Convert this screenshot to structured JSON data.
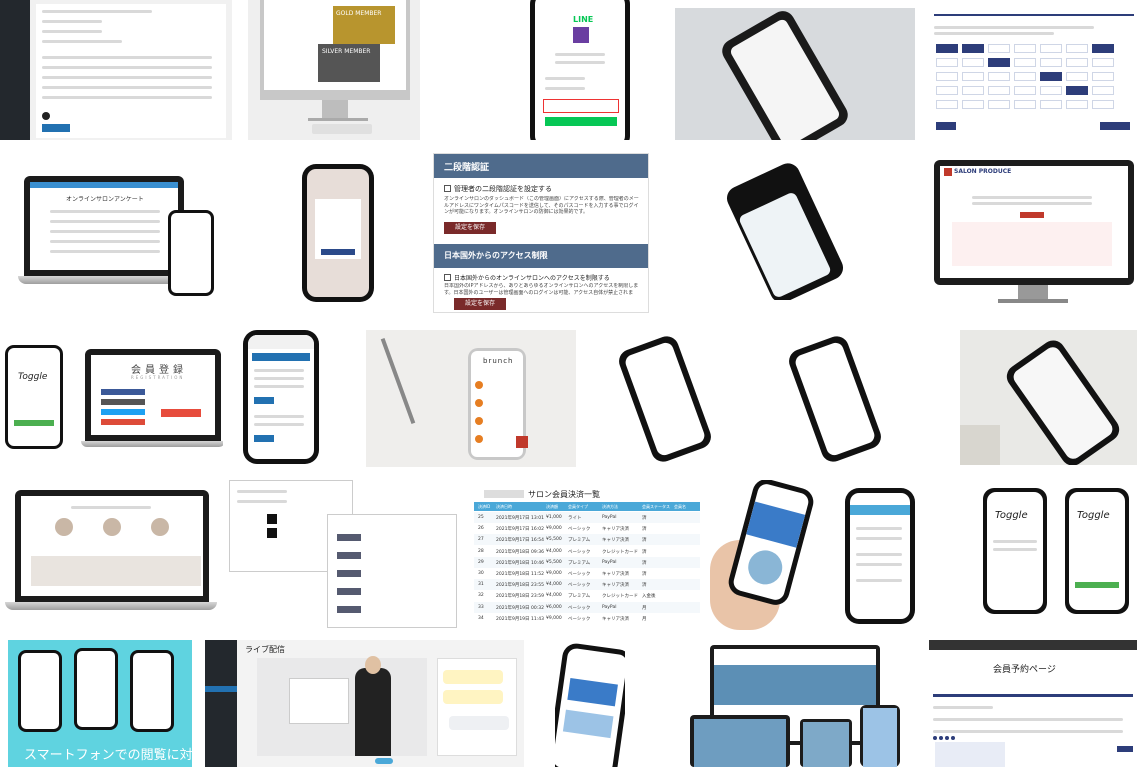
{
  "tiles": {
    "silver": {
      "gold_label": "GOLD MEMBER",
      "silver_label": "SILVER MEMBER"
    },
    "line_phone": {
      "brand": "LINE"
    },
    "online_salon": {
      "title": "オンラインサロンアンケート"
    },
    "security": {
      "two_factor_heading": "二段階認証",
      "two_factor_checkbox": "管理者の二段階認証を設定する",
      "two_factor_desc": "オンラインサロンのダッシュボード（この管理画面）にアクセスする際、管理者のメールアドレスにワンタイムパスコードを送信して、そのパスコードを入力する事でログインが可能になります。オンラインサロンの防御には効果的です。",
      "two_factor_save": "設定を保存",
      "geo_heading": "日本国外からのアクセス制限",
      "geo_checkbox": "日本国外からのオンラインサロンへのアクセスを制限する",
      "geo_desc": "日本国外のIPアドレスから、ありとあらゆるオンラインサロンへのアクセスを制限します。日本国外のユーザーは管理画面へのログインは可能、アクセス自体が禁止されます。",
      "geo_save": "設定を保存"
    },
    "salon_monitor": {
      "logo": "SALON PRODUCE"
    },
    "registration": {
      "brand": "Toggle",
      "title": "会員登録",
      "subtitle": "REGISTRATION"
    },
    "brunch": {
      "brand": "brunch"
    },
    "members_list": {
      "title": "サロン会員決済一覧",
      "columns": [
        "決済ID",
        "決済日時",
        "決済額",
        "会員タイプ",
        "決済方法",
        "会員ステータス",
        "会員名"
      ],
      "rows": [
        [
          "25",
          "2021年9月17日 13:01",
          "¥1,000",
          "ライト",
          "PayPal",
          "済",
          ""
        ],
        [
          "26",
          "2021年9月17日 16:02",
          "¥9,000",
          "ベーシック",
          "キャリア決済",
          "済",
          ""
        ],
        [
          "27",
          "2021年9月17日 16:54",
          "¥5,500",
          "プレミアム",
          "キャリア決済",
          "済",
          ""
        ],
        [
          "28",
          "2021年9月18日 09:36",
          "¥4,000",
          "ベーシック",
          "クレジットカード",
          "済",
          ""
        ],
        [
          "29",
          "2021年9月18日 10:46",
          "¥5,500",
          "プレミアム",
          "PayPal",
          "済",
          ""
        ],
        [
          "30",
          "2021年9月18日 11:52",
          "¥9,000",
          "ベーシック",
          "キャリア決済",
          "済",
          ""
        ],
        [
          "31",
          "2021年9月18日 23:55",
          "¥4,000",
          "ベーシック",
          "キャリア決済",
          "済",
          ""
        ],
        [
          "32",
          "2021年9月18日 23:59",
          "¥4,000",
          "プレミアム",
          "クレジットカード",
          "入金後",
          ""
        ],
        [
          "33",
          "2021年9月19日 00:32",
          "¥6,000",
          "ベーシック",
          "PayPal",
          "月",
          ""
        ],
        [
          "34",
          "2021年9月19日 11:43",
          "¥9,000",
          "ベーシック",
          "キャリア決済",
          "月",
          ""
        ]
      ]
    },
    "toggle_phones": {
      "brand": "Toggle"
    },
    "smartphone_banner": {
      "caption": "スマートフォンでの閲覧に対応"
    },
    "live_stream": {
      "title": "ライブ配信"
    },
    "reservation": {
      "title": "会員予約ページ"
    }
  },
  "colors": {
    "navy": "#2d3d7a",
    "salon_red": "#7a2a2a",
    "table_blue": "#4aa8d8",
    "cyan_bg": "#5fd3e0"
  }
}
